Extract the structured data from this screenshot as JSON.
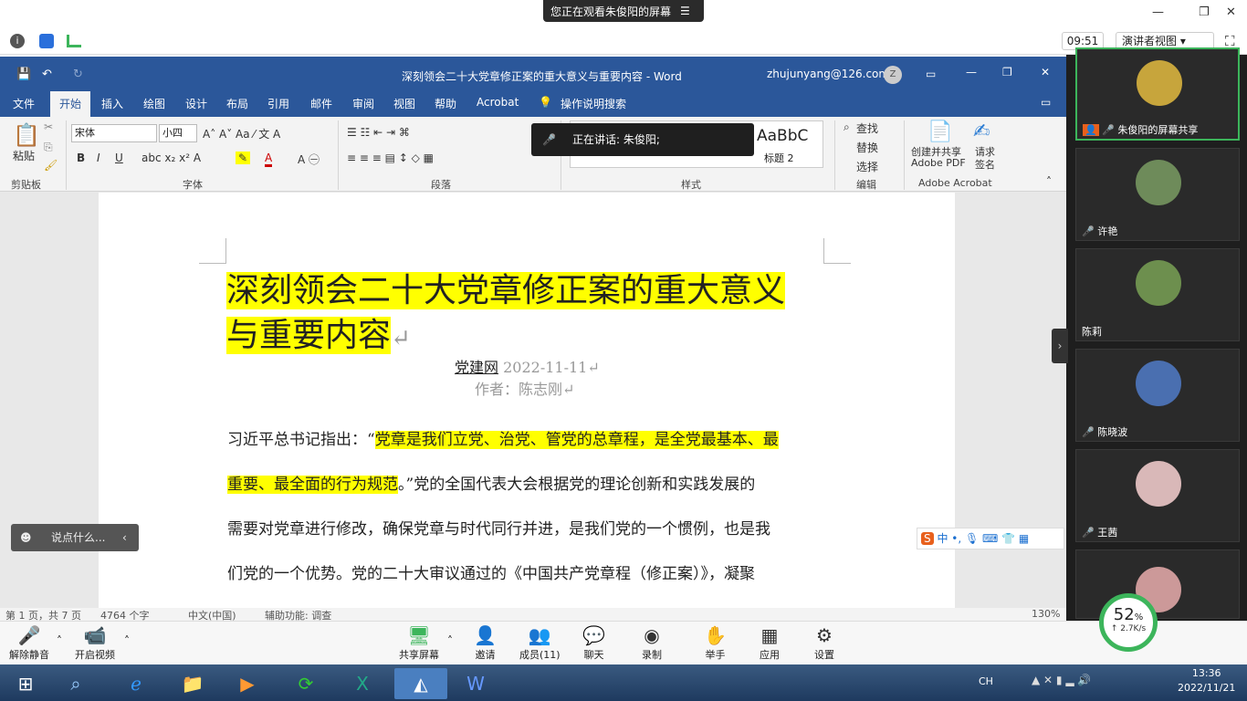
{
  "topbar": {
    "share_banner": "您正在观看朱俊阳的屏幕",
    "minimize": "—",
    "restore": "❐",
    "close": "✕"
  },
  "meetbar": {
    "timer": "09:51",
    "view_label": "演讲者视图"
  },
  "word": {
    "title": "深刻领会二十大党章修正案的重大意义与重要内容 - Word",
    "account": "zhujunyang@126.com",
    "account_initial": "Z",
    "tabs": [
      "文件",
      "开始",
      "插入",
      "绘图",
      "设计",
      "布局",
      "引用",
      "邮件",
      "审阅",
      "视图",
      "帮助",
      "Acrobat",
      "操作说明搜索"
    ],
    "ribbon": {
      "paste": "粘贴",
      "font_name": "宋体",
      "font_size": "小四",
      "groups": [
        "剪贴板",
        "字体",
        "段落",
        "样式",
        "编辑",
        "Adobe Acrobat"
      ],
      "styles": [
        "AaBbC",
        "标题 2"
      ],
      "find": "查找",
      "replace": "替换",
      "select": "选择",
      "create_pdf": "创建并共享",
      "create_pdf2": "Adobe PDF",
      "request_sign": "请求",
      "request_sign2": "签名"
    },
    "speaking": "正在讲话: 朱俊阳;",
    "document": {
      "title_line1": "深刻领会二十大党章修正案的重大意义",
      "title_line2": "与重要内容",
      "source": "党建网",
      "date": " 2022-11-11",
      "author": "作者：陈志刚",
      "para1_pre": "习近平总书记指出：“",
      "para1_hl": "党章是我们立党、治党、管党的总章程，是全党最基本、最",
      "line2_hl": "重要、最全面的行为规范",
      "line2_rest": "。”党的全国代表大会根据党的理论创新和实践发展的",
      "line3": "需要对党章进行修改，确保党章与时代同行并进，是我们党的一个惯例，也是我",
      "line4": "们党的一个优势。党的二十大审议通过的《中国共产党章程（修正案）》，凝聚"
    },
    "status": {
      "page": "第 1 页，共 7 页",
      "words": "4764 个字",
      "lang": "中文(中国)",
      "access": "辅助功能: 调查",
      "zoom": "130%"
    }
  },
  "participants": [
    {
      "name": "朱俊阳的屏幕共享",
      "color": "#c7a53c"
    },
    {
      "name": "许艳",
      "color": "#6e8b5a"
    },
    {
      "name": "陈莉",
      "color": "#6d8f4e"
    },
    {
      "name": "陈晓波",
      "color": "#4a6fb0"
    },
    {
      "name": "王茜",
      "color": "#d9b8b8"
    }
  ],
  "chat_input": "说点什么...",
  "ime": "中 •, 🎙 ⌨ 👕 ▦",
  "toolbar": {
    "unmute": "解除静音",
    "video": "开启视频",
    "share": "共享屏幕",
    "invite": "邀请",
    "members": "成员(11)",
    "chat": "聊天",
    "record": "录制",
    "raise": "举手",
    "apps": "应用",
    "settings": "设置"
  },
  "network": {
    "percent": "52",
    "unit": "%",
    "speed": "↑ 2.7K/s"
  },
  "taskbar": {
    "ime": "CH",
    "time": "13:36",
    "date": "2022/11/21"
  }
}
